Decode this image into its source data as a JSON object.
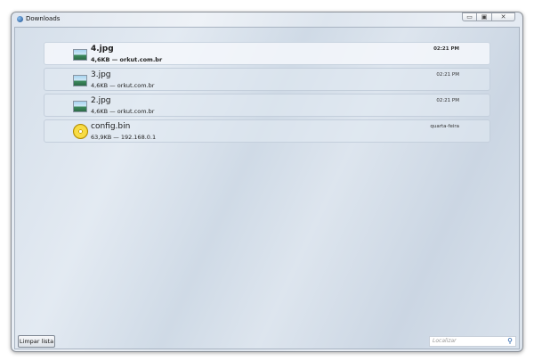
{
  "window": {
    "title": "Downloads",
    "minimize": "▭",
    "maximize": "▣",
    "close": "✕"
  },
  "downloads": [
    {
      "name": "4.jpg",
      "info": "4,6KB — orkut.com.br",
      "time": "02:21 PM",
      "icon": "image-file-icon",
      "selected": true
    },
    {
      "name": "3.jpg",
      "info": "4,6KB — orkut.com.br",
      "time": "02:21 PM",
      "icon": "image-file-icon"
    },
    {
      "name": "2.jpg",
      "info": "4,6KB — orkut.com.br",
      "time": "02:21 PM",
      "icon": "image-file-icon"
    },
    {
      "name": "config.bin",
      "info": "63,9KB — 192.168.0.1",
      "time": "quarta-feira",
      "icon": "disc-file-icon"
    }
  ],
  "footer": {
    "clear_label": "Limpar lista",
    "search_placeholder": "Localizar",
    "search_icon": "⚲"
  }
}
